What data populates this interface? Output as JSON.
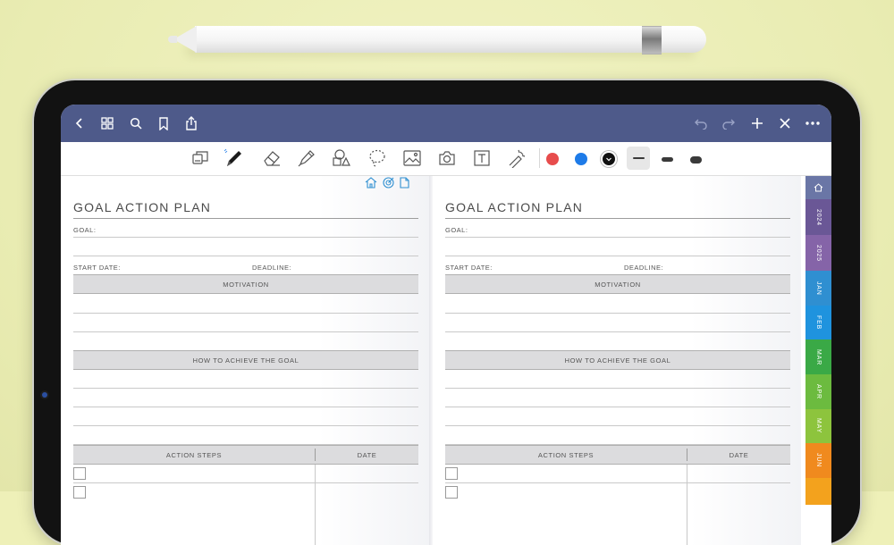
{
  "navbar": {
    "icons": [
      "chevron-left-icon",
      "grid-icon",
      "search-icon",
      "bookmark-icon",
      "share-icon",
      "undo-icon",
      "redo-icon",
      "plus-icon",
      "close-icon",
      "more-icon"
    ]
  },
  "toolbar": {
    "tools": [
      "page-layout-icon",
      "pen-icon",
      "eraser-icon",
      "highlighter-icon",
      "shapes-icon",
      "lasso-icon",
      "image-icon",
      "camera-icon",
      "text-icon",
      "laser-pointer-icon"
    ],
    "selected_tool": "pen-icon",
    "colors": [
      "#e74c4c",
      "#1e7be8",
      "#111111"
    ],
    "selected_color": "#111111",
    "stroke_widths": [
      "thin",
      "medium",
      "thick"
    ],
    "selected_stroke": "thin"
  },
  "left_page": {
    "header_icons": [
      "home-icon",
      "target-icon",
      "document-icon"
    ],
    "title": "GOAL ACTION PLAN",
    "goal_label": "GOAL:",
    "start_date_label": "START DATE:",
    "deadline_label": "DEADLINE:",
    "motivation": "MOTIVATION",
    "how_to": "HOW TO ACHIEVE THE GOAL",
    "action_steps": "ACTION STEPS",
    "date": "DATE"
  },
  "right_page": {
    "title": "GOAL ACTION PLAN",
    "goal_label": "GOAL:",
    "start_date_label": "START DATE:",
    "deadline_label": "DEADLINE:",
    "motivation": "MOTIVATION",
    "how_to": "HOW TO ACHIEVE THE GOAL",
    "action_steps": "ACTION STEPS",
    "date": "DATE"
  },
  "tabs": [
    {
      "label": "",
      "icon": "home-icon",
      "color": "#6a76a6"
    },
    {
      "label": "2024",
      "color": "#6a5796"
    },
    {
      "label": "2025",
      "color": "#8564a8"
    },
    {
      "label": "JAN",
      "color": "#2f8fd1"
    },
    {
      "label": "FEB",
      "color": "#1f93de"
    },
    {
      "label": "MAR",
      "color": "#3aa946"
    },
    {
      "label": "APR",
      "color": "#6cbb3f"
    },
    {
      "label": "MAY",
      "color": "#8dc43d"
    },
    {
      "label": "JUN",
      "color": "#f08a1e"
    },
    {
      "label": "",
      "color": "#f3a21d"
    }
  ]
}
